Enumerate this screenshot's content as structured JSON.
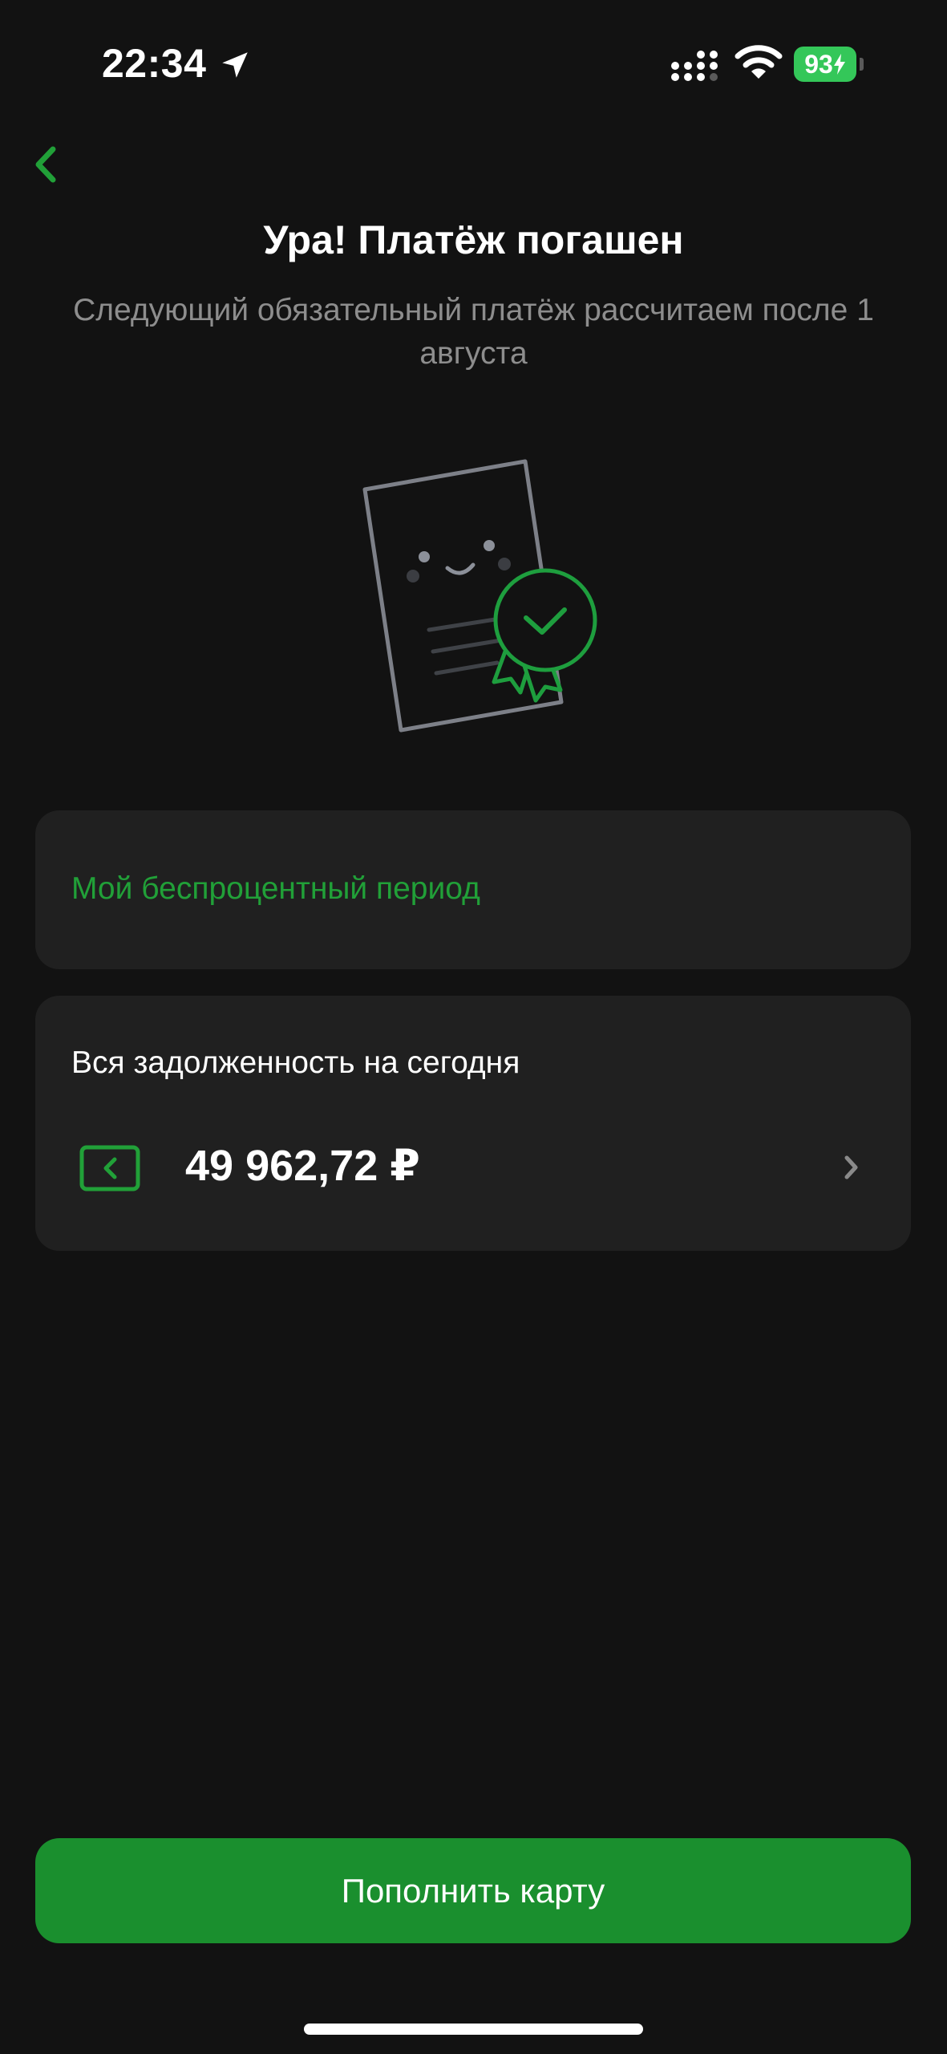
{
  "status_bar": {
    "time": "22:34",
    "battery_level": "93",
    "battery_color": "#34c759"
  },
  "header": {
    "back_icon": "chevron-left-icon",
    "title": "Ура! Платёж погашен",
    "subtitle": "Следующий обязательный платёж рассчитаем после 1 августа"
  },
  "illustration": {
    "icon": "receipt-with-checkmark-badge-icon"
  },
  "grace_card": {
    "link_label": "Мой беспроцентный период"
  },
  "debt_card": {
    "label": "Вся задолженность на сегодня",
    "amount": "49 962,72 ₽",
    "icon": "card-icon"
  },
  "actions": {
    "topup_label": "Пополнить карту"
  },
  "colors": {
    "background": "#121212",
    "card": "#202020",
    "accent_green": "#21a038",
    "button_green": "#1a8f2e",
    "subtitle_gray": "#8d8d8d"
  }
}
